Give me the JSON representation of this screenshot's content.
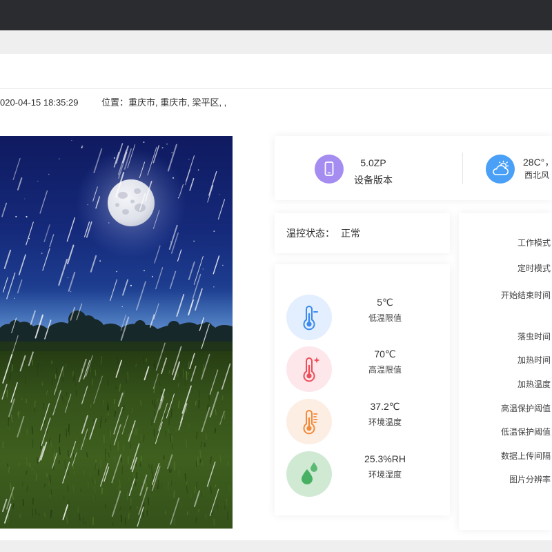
{
  "header": {
    "timestamp": "020-04-15 18:35:29",
    "location_label": "位置：",
    "location_value": "重庆市, 重庆市, 梁平区, ,"
  },
  "device_card": {
    "version_icon": "smartphone-icon",
    "version_icon_color": "#a58cf1",
    "version_value": "5.0ZP",
    "version_label": "设备版本",
    "weather_icon": "cloud-sun-icon",
    "weather_icon_color": "#4aa0f6",
    "weather_value": "28C°，",
    "weather_label": "西北风"
  },
  "temp_status": {
    "label": "温控状态：",
    "value": "正常"
  },
  "sensors": [
    {
      "value": "5℃",
      "label": "低温限值",
      "icon": "thermometer-low-icon",
      "color": "#3b8bef",
      "background": "#e3eefe"
    },
    {
      "value": "70℃",
      "label": "高温限值",
      "icon": "thermometer-high-icon",
      "color": "#ee4d5a",
      "background": "#fde7eb"
    },
    {
      "value": "37.2℃",
      "label": "环境温度",
      "icon": "thermometer-ambient-icon",
      "color": "#f28a3a",
      "background": "#fdeee4"
    },
    {
      "value": "25.3%RH",
      "label": "环境湿度",
      "icon": "humidity-droplets-icon",
      "color": "#48b062",
      "background": "#d0e9d3"
    }
  ],
  "settings": {
    "labels": [
      "工作模式",
      "定时模式",
      "开始结束时间",
      "落虫时间",
      "加热时间",
      "加热温度",
      "高温保护阈值",
      "低温保护阈值",
      "数据上传间隔",
      "图片分辨率"
    ]
  }
}
